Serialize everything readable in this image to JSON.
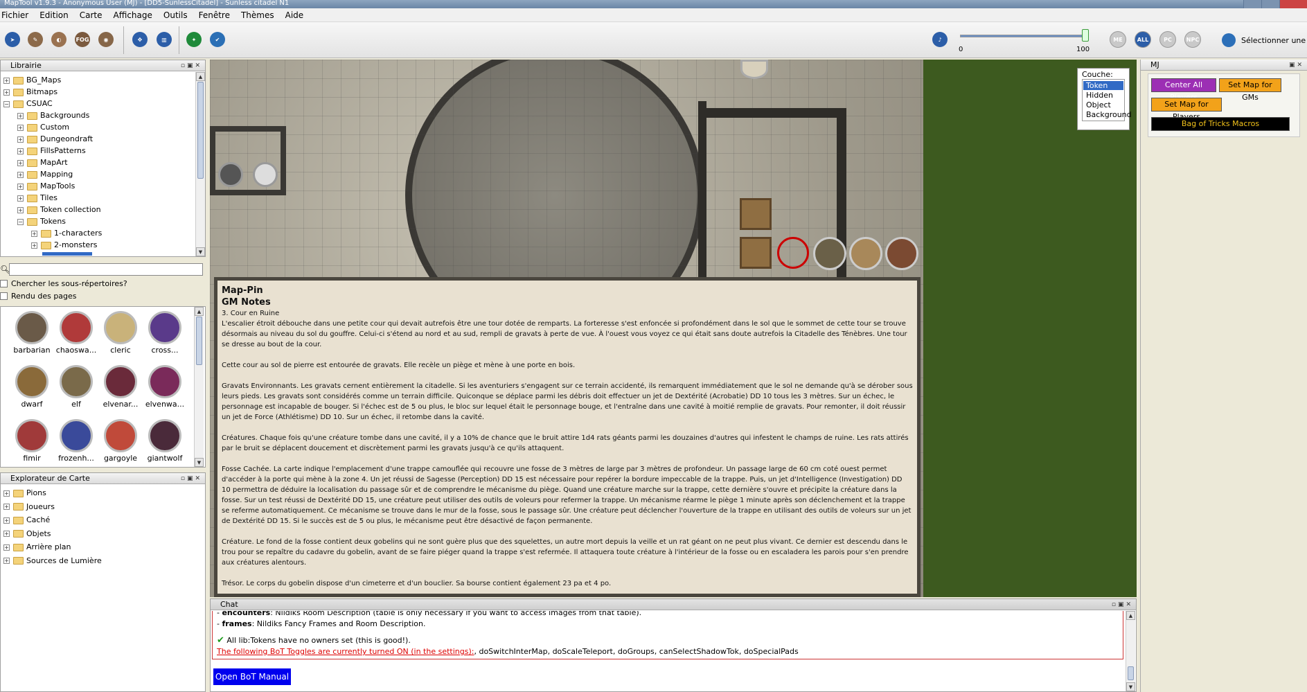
{
  "window": {
    "title": "MapTool v1.9.3 - Anonymous User (MJ) - [DD5-SunlessCitadel] - Sunless citadel N1"
  },
  "menu": [
    "Fichier",
    "Edition",
    "Carte",
    "Affichage",
    "Outils",
    "Fenêtre",
    "Thèmes",
    "Aide"
  ],
  "toolbar": {
    "fog_label": "FOG",
    "volume_min": "0",
    "volume_max": "100",
    "volume_value": 100,
    "toggles": [
      "ME",
      "ALL",
      "PC",
      "NPC"
    ],
    "select_label": "Sélectionner une ca"
  },
  "library": {
    "title": "Librairie",
    "tree": [
      {
        "label": "BG_Maps",
        "level": 0
      },
      {
        "label": "Bitmaps",
        "level": 0
      },
      {
        "label": "CSUAC",
        "level": 0,
        "open": true
      },
      {
        "label": "Backgrounds",
        "level": 1
      },
      {
        "label": "Custom",
        "level": 1
      },
      {
        "label": "Dungeondraft",
        "level": 1
      },
      {
        "label": "FillsPatterns",
        "level": 1
      },
      {
        "label": "MapArt",
        "level": 1
      },
      {
        "label": "Mapping",
        "level": 1
      },
      {
        "label": "MapTools",
        "level": 1
      },
      {
        "label": "Tiles",
        "level": 1
      },
      {
        "label": "Token collection",
        "level": 1
      },
      {
        "label": "Tokens",
        "level": 1,
        "open": true
      },
      {
        "label": "1-characters",
        "level": 2
      },
      {
        "label": "2-monsters",
        "level": 2
      }
    ],
    "search_value": "",
    "subdirs_label": "Chercher les sous-répertoires?",
    "render_label": "Rendu des pages",
    "tokens": [
      "barbarian",
      "chaoswa...",
      "cleric",
      "cross...",
      "dwarf",
      "elf",
      "elvenar...",
      "elvenwa...",
      "fimir",
      "frozenh...",
      "gargoyle",
      "giantwolf"
    ]
  },
  "explorer": {
    "title": "Explorateur de Carte",
    "items": [
      "Pions",
      "Joueurs",
      "Caché",
      "Objets",
      "Arrière plan",
      "Sources de Lumière"
    ]
  },
  "layers": {
    "title": "Couche:",
    "options": [
      "Token",
      "Hidden",
      "Object",
      "Background"
    ],
    "selected": "Token"
  },
  "note": {
    "title": "Map-Pin",
    "subtitle": "GM Notes",
    "room": "3. Cour en Ruine",
    "paragraphs": [
      "L'escalier étroit débouche dans une petite cour qui devait autrefois être une tour dotée de remparts. La forteresse s'est enfoncée si profondément dans le sol que le sommet de cette tour se trouve désormais au niveau du sol du gouffre. Celui-ci s'étend au nord et au sud, rempli de gravats à perte de vue. À l'ouest vous voyez ce qui était sans doute autrefois la Citadelle des Ténèbres. Une tour se dresse au bout de la cour.",
      "Cette cour au sol de pierre est entourée de gravats. Elle recèle un piège et mène à une porte en bois.",
      "Gravats Environnants. Les gravats cernent entièrement la citadelle. Si les aventuriers s'engagent sur ce terrain accidenté, ils remarquent immédiatement que le sol ne demande qu'à se dérober sous leurs pieds. Les gravats sont considérés comme un terrain difficile. Quiconque se déplace parmi les débris doit effectuer un jet de Dextérité (Acrobatie) DD 10 tous les 3 mètres. Sur un échec, le personnage est incapable de bouger. Si l'échec est de 5 ou plus, le bloc sur lequel était le personnage bouge, et l'entraîne dans une cavité à moitié remplie de gravats. Pour remonter, il doit réussir un jet de Force (Athlétisme) DD 10. Sur un échec, il retombe dans la cavité.",
      "Créatures. Chaque fois qu'une créature tombe dans une cavité, il y a 10% de chance que le bruit attire 1d4 rats géants parmi les douzaines d'autres qui infestent le champs de ruine. Les rats attirés par le bruit se déplacent doucement et discrètement parmi les gravats jusqu'à ce qu'ils attaquent.",
      "Fosse Cachée. La carte indique l'emplacement d'une trappe camouflée qui recouvre une fosse de 3 mètres de large par 3 mètres de profondeur. Un passage large de 60 cm coté ouest permet d'accéder à la porte qui mène à la zone 4. Un jet réussi de Sagesse (Perception) DD 15 est nécessaire pour repérer la bordure impeccable de la trappe. Puis, un jet d'Intelligence (Investigation) DD 10 permettra de déduire la localisation du passage sûr et de comprendre le mécanisme du piège. Quand une créature marche sur la trappe, cette dernière s'ouvre et précipite la créature dans la fosse. Sur un test réussi de Dextérité DD 15, une créature peut utiliser des outils de voleurs pour refermer la trappe. Un mécanisme réarme le piège 1 minute après son déclenchement et la trappe se referme automatiquement. Ce mécanisme se trouve dans le mur de la fosse, sous le passage sûr. Une créature peut déclencher l'ouverture de la trappe en utilisant des outils de voleurs sur un jet de Dextérité DD 15. Si le succès est de 5 ou plus, le mécanisme peut être désactivé de façon permanente.",
      "Créature. Le fond de la fosse contient deux gobelins qui ne sont guère plus que des squelettes, un autre mort depuis la veille et un rat géant on ne peut plus vivant. Ce dernier est descendu dans le trou pour se repaître du cadavre du gobelin, avant de se faire piéger quand la trappe s'est refermée. Il attaquera toute créature à l'intérieur de la fosse ou en escaladera les parois pour s'en prendre aux créatures alentours.",
      "Trésor. Le corps du gobelin dispose d'un cimeterre et d'un bouclier. Sa bourse contient également 23 pa et 4 po."
    ]
  },
  "chat": {
    "title": "Chat",
    "line0_tail": ": Nildiks Room Description (table is only necessary if you want to access images from that table).",
    "line1_key": "frames",
    "line1_text": ": Nildiks Fancy Frames and Room Description.",
    "line2": "All lib:Tokens have no owners set (this is good!).",
    "line3_link": "The following BoT Toggles are currently turned ON (in the settings):",
    "line3_rest": ", doSwitchInterMap, doScaleTeleport, doGroups, canSelectShadowTok, doSpecialPads",
    "button": "Open BoT Manual"
  },
  "mj": {
    "title": "MJ",
    "buttons": [
      "Center All Players",
      "Set Map for GMs",
      "Set Map for Players",
      "Bag of Tricks Macros"
    ]
  }
}
